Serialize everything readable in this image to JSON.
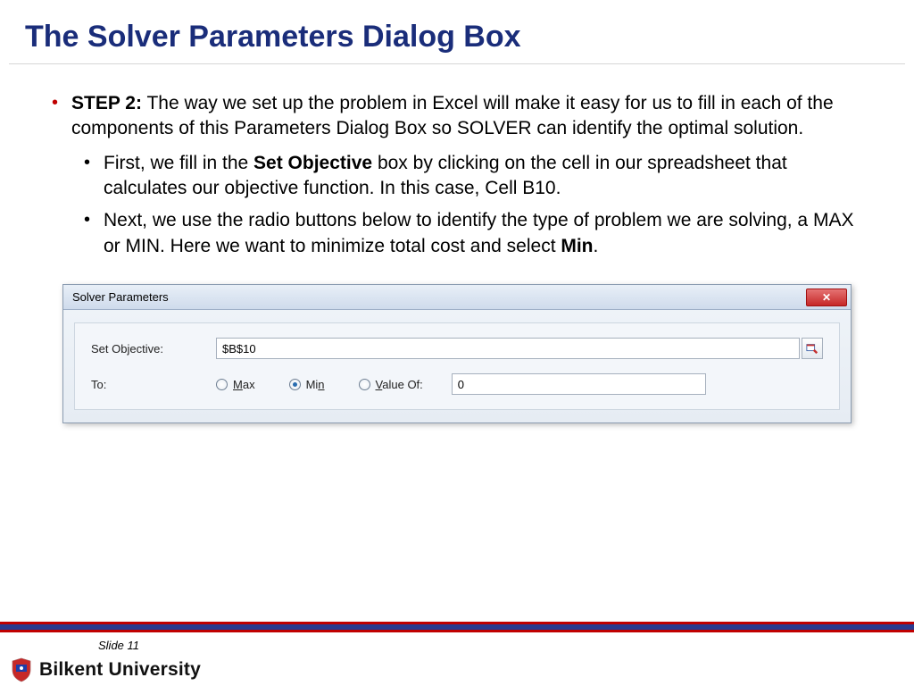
{
  "title": "The Solver Parameters Dialog Box",
  "step": {
    "label": "STEP 2:",
    "text": " The way we set up the problem in Excel will make it easy for us to fill in each of the components of this Parameters Dialog Box so SOLVER can identify the optimal solution."
  },
  "sub1": {
    "pre": "First, we fill in the ",
    "bold": "Set Objective",
    "post": " box by clicking on the cell in our spreadsheet that calculates our objective function. In this case, Cell B10."
  },
  "sub2": {
    "pre": "Next, we use the radio buttons below to identify the type of problem we are solving, a MAX or MIN. Here we want to minimize total cost and select ",
    "bold": "Min",
    "post": "."
  },
  "dialog": {
    "title": "Solver Parameters",
    "setObjectiveLabel": "Set Objective:",
    "setObjectiveValue": "$B$10",
    "toLabel": "To:",
    "max": {
      "u": "M",
      "rest": "ax"
    },
    "min": {
      "pre": "Mi",
      "u": "n"
    },
    "valueOf": {
      "u": "V",
      "rest": "alue Of:"
    },
    "valueOfInput": "0"
  },
  "footer": {
    "slide": "Slide 11",
    "university": "Bilkent University"
  }
}
